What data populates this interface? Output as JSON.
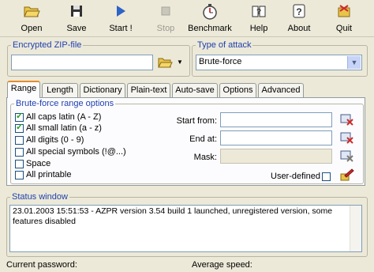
{
  "toolbar": {
    "buttons": [
      {
        "label": "Open",
        "icon": "folder-open-icon",
        "enabled": true
      },
      {
        "label": "Save",
        "icon": "floppy-disk-icon",
        "enabled": true
      },
      {
        "label": "Start !",
        "icon": "play-icon",
        "enabled": true
      },
      {
        "label": "Stop",
        "icon": "stop-icon",
        "enabled": false
      },
      {
        "label": "Benchmark",
        "icon": "stopwatch-icon",
        "enabled": true
      },
      {
        "label": "Help",
        "icon": "help-book-icon",
        "enabled": true
      },
      {
        "label": "About",
        "icon": "about-question-icon",
        "enabled": true
      },
      {
        "label": "Quit",
        "icon": "exit-door-icon",
        "enabled": true
      }
    ]
  },
  "zip": {
    "legend": "Encrypted ZIP-file",
    "value": ""
  },
  "attack": {
    "legend": "Type of attack",
    "selected": "Brute-force"
  },
  "tabs": [
    "Range",
    "Length",
    "Dictionary",
    "Plain-text",
    "Auto-save",
    "Options",
    "Advanced"
  ],
  "range": {
    "legend": "Brute-force range options",
    "options": [
      {
        "label": "All caps latin (A - Z)",
        "checked": true
      },
      {
        "label": "All small latin (a - z)",
        "checked": true
      },
      {
        "label": "All digits (0 - 9)",
        "checked": false
      },
      {
        "label": "All special symbols (!@...)",
        "checked": false
      },
      {
        "label": "Space",
        "checked": false
      },
      {
        "label": "All printable",
        "checked": false
      }
    ],
    "start_from_label": "Start from:",
    "end_at_label": "End at:",
    "mask_label": "Mask:",
    "user_defined_label": "User-defined",
    "start_from": "",
    "end_at": "",
    "mask": ""
  },
  "status": {
    "legend": "Status window",
    "text": "23.01.2003 15:51:53 - AZPR version 3.54 build 1 launched, unregistered version, some features disabled"
  },
  "footer": {
    "current_password_label": "Current password:",
    "average_speed_label": "Average speed:"
  },
  "colors": {
    "background": "#ece9d8",
    "legend": "#1f3fb0",
    "active_tab_accent": "#e68b2c"
  }
}
